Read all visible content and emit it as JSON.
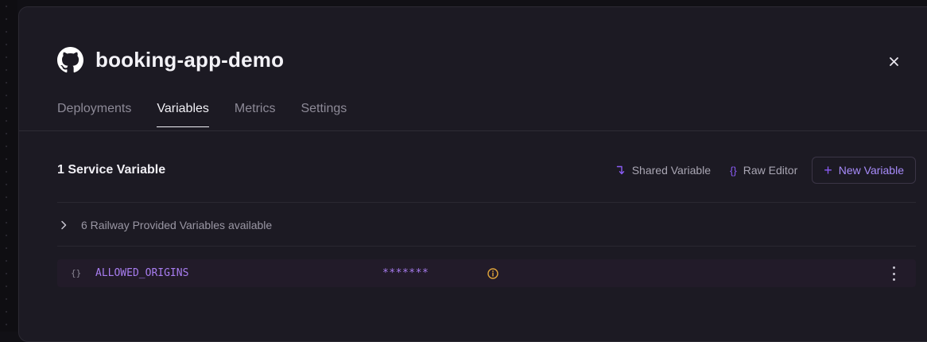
{
  "service": {
    "title": "booking-app-demo",
    "icon": "github-icon"
  },
  "tabs": [
    {
      "label": "Deployments",
      "active": false
    },
    {
      "label": "Variables",
      "active": true
    },
    {
      "label": "Metrics",
      "active": false
    },
    {
      "label": "Settings",
      "active": false
    }
  ],
  "variables": {
    "section_title": "1 Service Variable",
    "actions": {
      "shared_label": "Shared Variable",
      "raw_editor_label": "Raw Editor",
      "raw_editor_glyph": "{}",
      "new_variable_label": "New Variable",
      "new_variable_glyph": "+"
    },
    "provided_text": "6 Railway Provided Variables available",
    "rows": [
      {
        "brace": "{}",
        "name": "ALLOWED_ORIGINS",
        "value": "*******"
      }
    ]
  },
  "colors": {
    "accent": "#8b5cf6",
    "variable_text": "#a87df0",
    "warning": "#e0a43a",
    "panel_bg": "#1c1a23"
  }
}
